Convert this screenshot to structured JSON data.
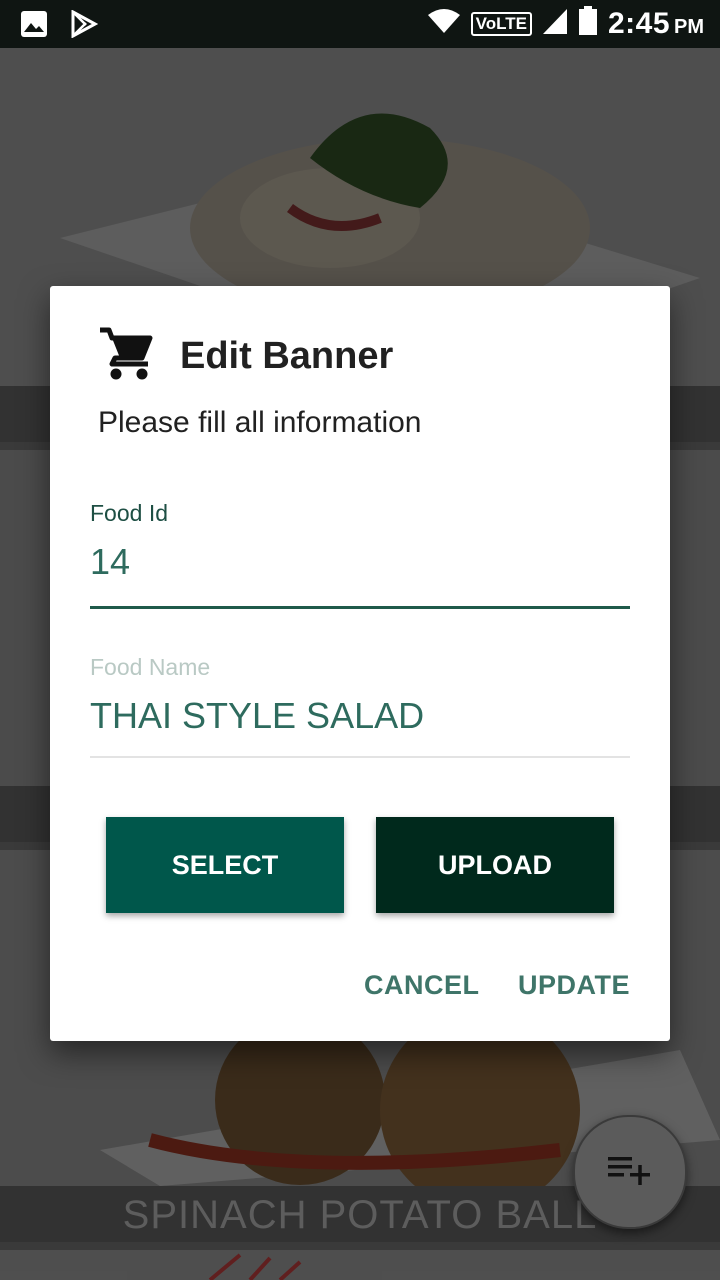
{
  "status_bar": {
    "time": "2:45",
    "ampm": "PM",
    "network_label": "VoLTE",
    "icons": [
      "image-icon",
      "play-store-icon",
      "wifi-icon",
      "signal-icon",
      "battery-icon"
    ]
  },
  "background_list": {
    "visible_caption": "SPINACH POTATO BALL"
  },
  "dialog": {
    "icon": "cart-icon",
    "title": "Edit Banner",
    "subtitle": "Please fill all information",
    "fields": [
      {
        "label": "Food Id",
        "value": "14"
      },
      {
        "label": "Food Name",
        "value": "THAI STYLE SALAD"
      }
    ],
    "buttons": {
      "select": "SELECT",
      "upload": "UPLOAD"
    },
    "actions": {
      "cancel": "CANCEL",
      "update": "UPDATE"
    }
  },
  "fab": {
    "icon": "playlist-add-icon"
  },
  "colors": {
    "primary": "#00574b",
    "primary_dark": "#00291c",
    "accent_text": "#3f7569"
  }
}
